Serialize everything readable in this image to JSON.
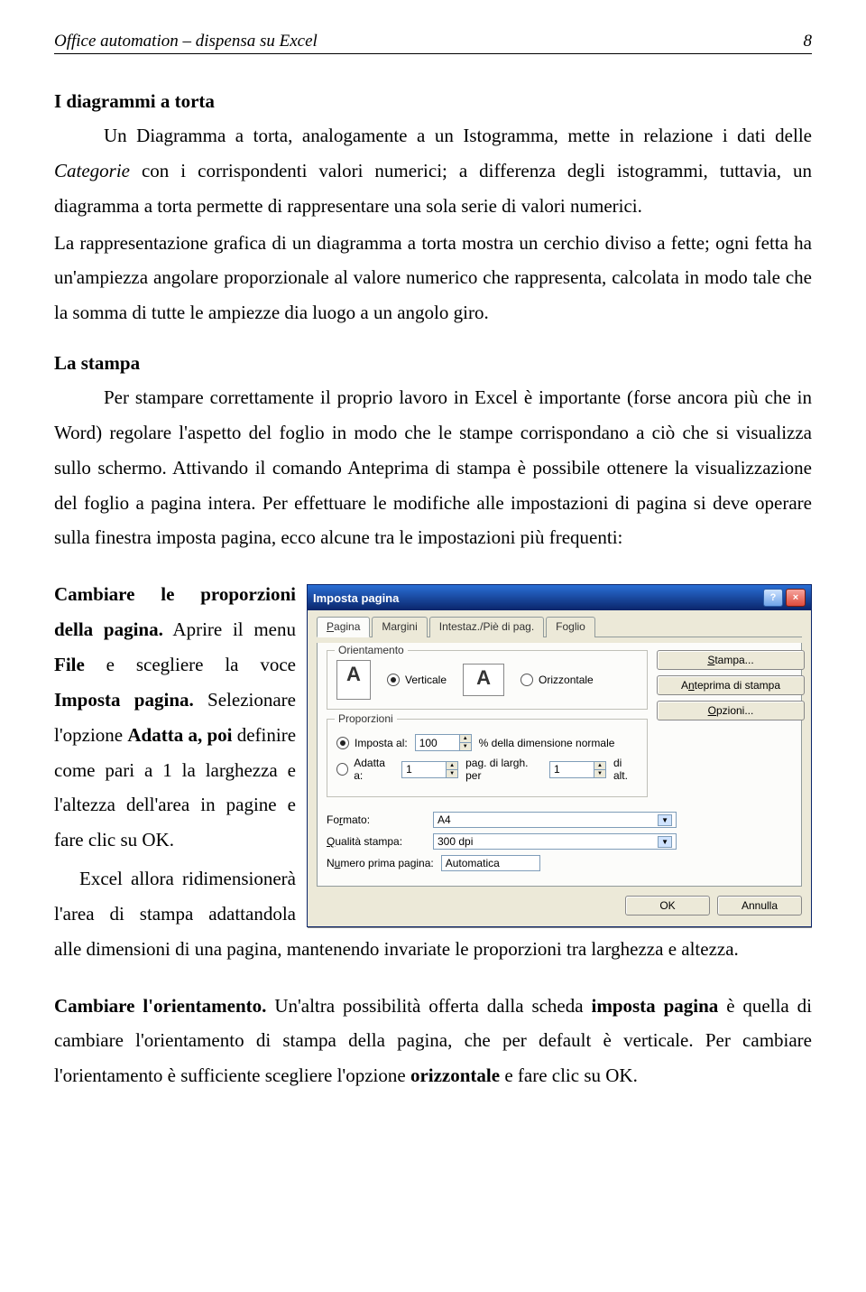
{
  "header": {
    "left": "Office automation – dispensa su Excel",
    "page": "8"
  },
  "sec1": {
    "title": "I diagrammi a torta",
    "p1a": "Un Diagramma a torta, analogamente a un Istogramma, mette in relazione i dati delle ",
    "p1b": "Categorie",
    "p1c": " con i corrispondenti valori numerici; a differenza degli istogrammi, tuttavia, un diagramma a torta permette di rappresentare una sola serie di valori numerici.",
    "p2": "La rappresentazione grafica di un diagramma a torta mostra un cerchio diviso a fette; ogni fetta ha un'ampiezza angolare proporzionale al valore numerico che rappresenta, calcolata in modo tale che la somma di tutte le ampiezze dia luogo a un angolo giro."
  },
  "sec2": {
    "title": "La stampa",
    "p1": "Per stampare correttamente il proprio lavoro in Excel è importante (forse ancora più che in Word) regolare l'aspetto del foglio in modo che le stampe corrispondano a ciò che si visualizza sullo schermo. Attivando il comando Anteprima di stampa è possibile ottenere la visualizzazione del foglio a pagina intera. Per effettuare le modifiche alle impostazioni di pagina si deve operare sulla finestra imposta pagina, ecco alcune tra le impostazioni più frequenti:",
    "p2a": "Cambiare le proporzioni della pagina.",
    "p2b": " Aprire il menu ",
    "p2c": "File",
    "p2d": " e scegliere la voce ",
    "p2e": "Imposta pagina.",
    "p2f": " Selezionare l'opzione ",
    "p2g": "Adatta a, poi",
    "p2h": " definire come pari a 1 la larghezza e l'altezza dell'area in pagine e fare clic su OK.",
    "p3": "Excel allora ridimensionerà l'area di stampa adattandola alle dimensioni di una pagina, mantenendo invariate le proporzioni tra larghezza e altezza."
  },
  "sec3": {
    "p1a": "Cambiare l'orientamento.",
    "p1b": " Un'altra possibilità offerta dalla scheda ",
    "p1c": "imposta pagina",
    "p1d": " è quella di cambiare l'orientamento di stampa della pagina, che per default è verticale. Per cambiare l'orientamento è sufficiente scegliere l'opzione ",
    "p1e": "orizzontale",
    "p1f": " e fare clic su OK."
  },
  "dialog": {
    "title": "Imposta pagina",
    "tabs": {
      "t1": "Pagina",
      "t2": "Margini",
      "t3": "Intestaz./Piè di pag.",
      "t4": "Foglio"
    },
    "orient": {
      "label": "Orientamento",
      "vertical": "Verticale",
      "horizontal": "Orizzontale",
      "iconA": "A"
    },
    "buttons": {
      "stampa": "Stampa...",
      "anteprima": "Anteprima di stampa",
      "opzioni": "Opzioni..."
    },
    "prop": {
      "label": "Proporzioni",
      "imposta": "Imposta al:",
      "imposta_val": "100",
      "imposta_suffix": "% della dimensione normale",
      "adatta": "Adatta a:",
      "adatta_w": "1",
      "adatta_mid": "pag. di largh. per",
      "adatta_h": "1",
      "adatta_suffix": "di alt."
    },
    "formato": {
      "label": "Formato:",
      "value": "A4"
    },
    "qualita": {
      "label": "Qualità stampa:",
      "value": "300 dpi"
    },
    "numero": {
      "label": "Numero prima pagina:",
      "value": "Automatica"
    },
    "ok": "OK",
    "annulla": "Annulla"
  }
}
